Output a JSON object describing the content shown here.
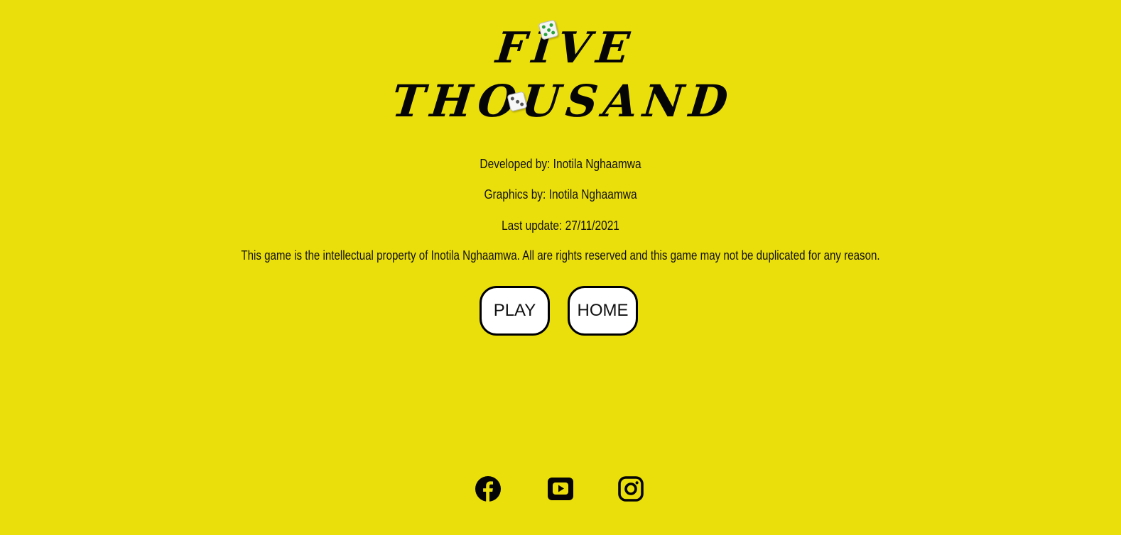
{
  "logo": {
    "line1": "FIVE",
    "line2": "THOUSAND"
  },
  "credits": {
    "developed": "Developed by: Inotila Nghaamwa",
    "graphics": "Graphics by: Inotila Nghaamwa",
    "updated": "Last update: 27/11/2021",
    "copyright": "This game is the intellectual property of Inotila Nghaamwa. All are rights reserved and this game may not be duplicated for any reason."
  },
  "buttons": {
    "play": "PLAY",
    "home": "HOME"
  },
  "social": [
    {
      "icon": "facebook-icon"
    },
    {
      "icon": "youtube-icon"
    },
    {
      "icon": "instagram-icon"
    }
  ],
  "colors": {
    "background": "#ebdf0b",
    "button_bg": "#ffffff",
    "border": "#000000"
  }
}
